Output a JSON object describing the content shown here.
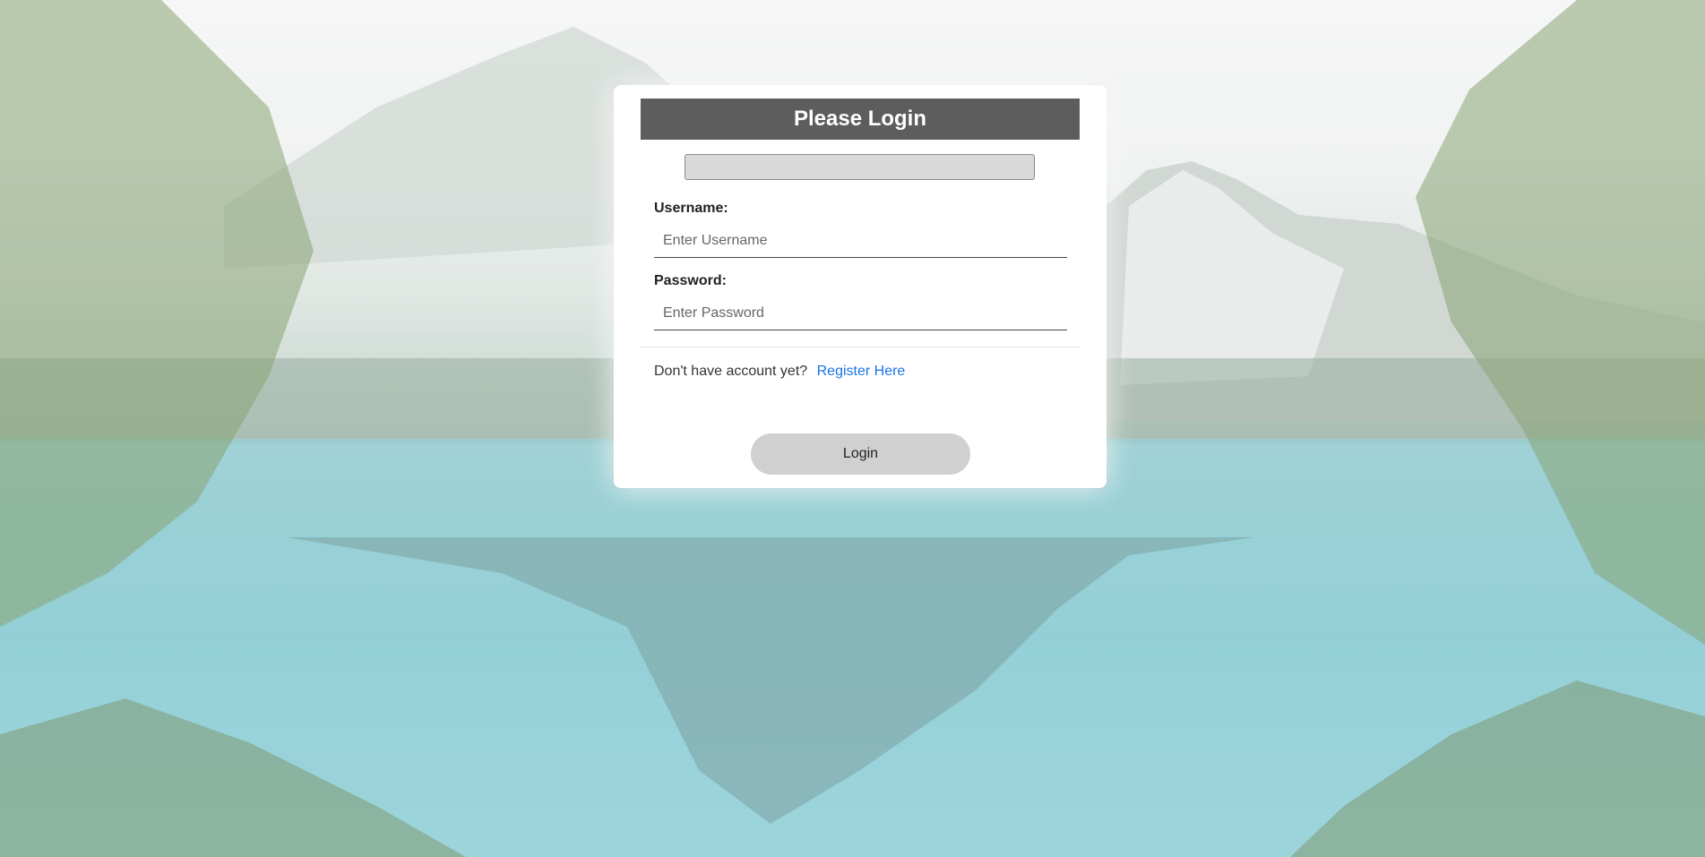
{
  "login": {
    "title": "Please Login",
    "message": "",
    "username_label": "Username:",
    "username_placeholder": "Enter Username",
    "password_label": "Password:",
    "password_placeholder": "Enter Password",
    "register_prompt": "Don't have account yet?",
    "register_link": "Register Here",
    "submit_label": "Login"
  },
  "colors": {
    "header_bg": "#5d5d5d",
    "link": "#1a73e8",
    "button_bg": "#d0d0d0"
  }
}
